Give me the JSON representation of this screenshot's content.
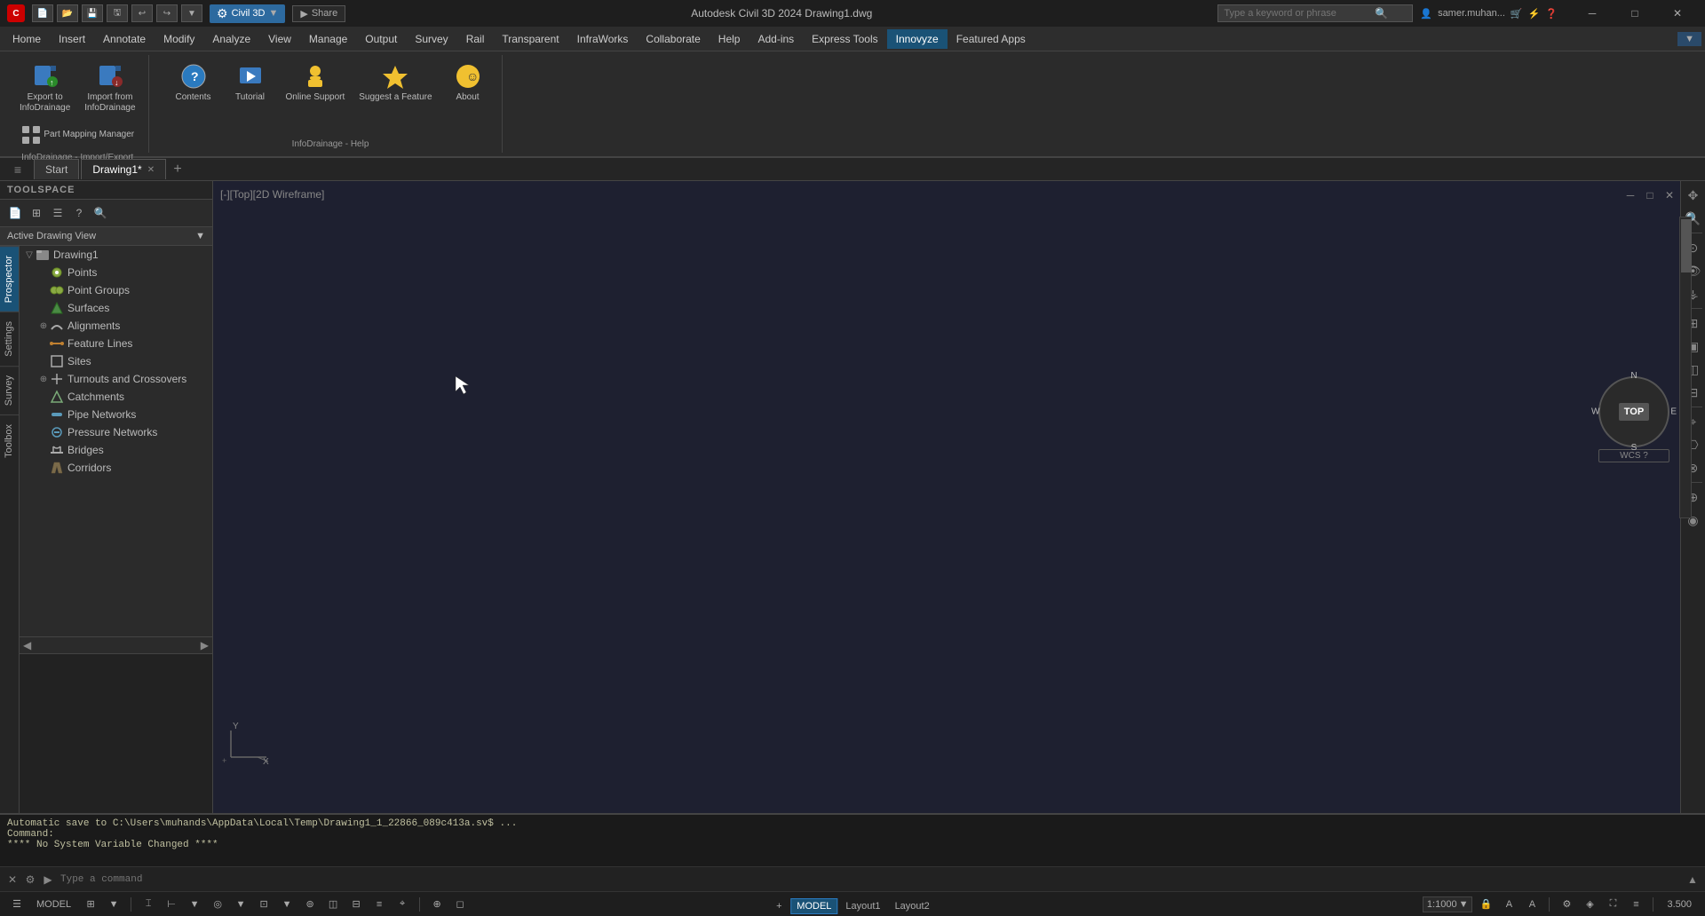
{
  "titlebar": {
    "app_icon": "C",
    "app_name": "Civil 3D",
    "share_label": "Share",
    "title": "Autodesk Civil 3D 2024  Drawing1.dwg",
    "search_placeholder": "Type a keyword or phrase",
    "user": "samer.muhan...",
    "minimize": "─",
    "maximize": "□",
    "close": "✕"
  },
  "menubar": {
    "items": [
      {
        "label": "Home"
      },
      {
        "label": "Insert"
      },
      {
        "label": "Annotate"
      },
      {
        "label": "Modify"
      },
      {
        "label": "Analyze"
      },
      {
        "label": "View"
      },
      {
        "label": "Manage"
      },
      {
        "label": "Output"
      },
      {
        "label": "Survey"
      },
      {
        "label": "Rail"
      },
      {
        "label": "Transparent"
      },
      {
        "label": "InfraWorks"
      },
      {
        "label": "Collaborate"
      },
      {
        "label": "Help"
      },
      {
        "label": "Add-ins"
      },
      {
        "label": "Express Tools"
      },
      {
        "label": "Collaborate",
        "hidden": true
      },
      {
        "label": "Innovyze",
        "active": true
      },
      {
        "label": "Featured Apps"
      }
    ]
  },
  "ribbon": {
    "infodrainage_group": {
      "title": "InfoDrainage - Import/Export",
      "export_label": "Export to InfoDrainage",
      "import_label": "Import from InfoDrainage",
      "part_mapping_label": "Part Mapping Manager"
    },
    "help_group": {
      "title": "InfoDrainage - Help",
      "contents_label": "Contents",
      "tutorial_label": "Tutorial",
      "online_support_label": "Online Support",
      "suggest_label": "Suggest a Feature",
      "about_label": "About"
    }
  },
  "tabs": {
    "hamburger": "≡",
    "start_label": "Start",
    "drawing1_label": "Drawing1*",
    "add_tab": "+"
  },
  "toolspace": {
    "title": "TOOLSPACE",
    "dropdown_label": "Active Drawing View",
    "tree": {
      "root": "Drawing1",
      "items": [
        {
          "label": "Points",
          "level": 1,
          "has_children": false,
          "icon": "dot"
        },
        {
          "label": "Point Groups",
          "level": 1,
          "has_children": false,
          "icon": "dot"
        },
        {
          "label": "Surfaces",
          "level": 1,
          "has_children": false,
          "icon": "surface"
        },
        {
          "label": "Alignments",
          "level": 1,
          "has_children": true,
          "icon": "alignment"
        },
        {
          "label": "Feature Lines",
          "level": 1,
          "has_children": false,
          "icon": "featureline"
        },
        {
          "label": "Sites",
          "level": 1,
          "has_children": false,
          "icon": "site"
        },
        {
          "label": "Turnouts and Crossovers",
          "level": 1,
          "has_children": false,
          "icon": "turnout"
        },
        {
          "label": "Catchments",
          "level": 1,
          "has_children": false,
          "icon": "catchment"
        },
        {
          "label": "Pipe Networks",
          "level": 1,
          "has_children": false,
          "icon": "pipe"
        },
        {
          "label": "Pressure Networks",
          "level": 1,
          "has_children": false,
          "icon": "pressure"
        },
        {
          "label": "Bridges",
          "level": 1,
          "has_children": false,
          "icon": "bridge"
        },
        {
          "label": "Corridors",
          "level": 1,
          "has_children": false,
          "icon": "corridor"
        }
      ]
    }
  },
  "side_tabs": [
    "Prospector",
    "Settings",
    "Survey",
    "Toolbox"
  ],
  "viewport": {
    "label": "[-][Top][2D Wireframe]",
    "compass": {
      "N": "N",
      "S": "S",
      "E": "E",
      "W": "W",
      "center": "TOP",
      "wcs": "WCS ?"
    }
  },
  "command": {
    "output_lines": [
      "Automatic save to C:\\Users\\muhands\\AppData\\Local\\Temp\\Drawing1_1_22866_089c413a.sv$ ...",
      "Command:",
      "**** No System Variable Changed ****"
    ],
    "input_placeholder": "Type a command"
  },
  "statusbar": {
    "model_label": "MODEL",
    "scale_label": "1:1000",
    "zoom_label": "3.500",
    "layout1": "Layout1",
    "layout2": "Layout2"
  }
}
